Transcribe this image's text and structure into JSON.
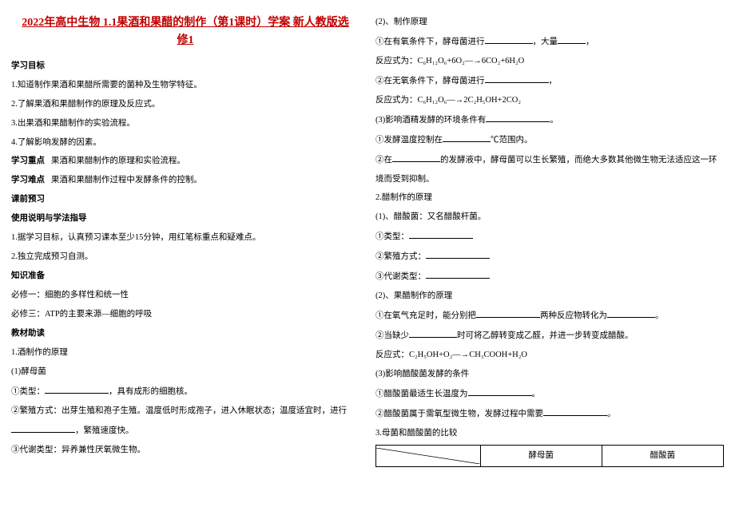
{
  "title_line1": "2022年高中生物 1.1果酒和果醋的制作（第1课时）学案 新人教版选",
  "title_line2": "修1",
  "s_goals_h": "学习目标",
  "goals": [
    "1.知道制作果酒和果醋所需要的菌种及生物学特征。",
    "2.了解果酒和果醋制作的原理及反应式。",
    "3.出果酒和果醋制作的实验流程。",
    "4.了解影响发酵的因素。"
  ],
  "s_focus_h": "学习重点",
  "s_focus_c": "果酒和果醋制作的原理和实验流程。",
  "s_diff_h": "学习难点",
  "s_diff_c": "果酒和果醋制作过程中发酵条件的控制。",
  "s_pre_h": "课前预习",
  "s_guide_h": "使用说明与学法指导",
  "guide1": "1.据学习目标，认真预习课本至少15分钟，用红笔标重点和疑难点。",
  "guide2": "2.独立完成预习自测。",
  "s_prep_h": "知识准备",
  "prep1": "必修一：细胞的多样性和统一性",
  "prep2": "必修三：ATP的主要来源—细胞的呼吸",
  "s_text_h": "教材助读",
  "w1": "1.酒制作的原理",
  "w1_1": "(1)酵母菌",
  "w1_1a_pre": "①类型：",
  "w1_1a_post": "，具有成形的细胞核。",
  "w1_1b": "②繁殖方式：出芽生殖和孢子生殖。温度低时形成孢子，进入休眠状态；温度适宜时，进行",
  "w1_1b_post": "，繁殖速度快。",
  "w1_1c": "③代谢类型：异养兼性厌氧微生物。",
  "w1_2": "(2)、制作原理",
  "w1_2a_pre": "①在有氧条件下，酵母菌进行",
  "w1_2a_mid": "，大量",
  "w1_2a_post": "，",
  "w1_2a_eq": "反应式为：C₆H₁₂O₆+6O₂—→6CO₂+6H₂O",
  "w1_2b_pre": "②在无氧条件下，酵母菌进行",
  "w1_2b_post": "，",
  "w1_2b_eq": "反应式为：C₆H₁₂O₆—→2C₂H₅OH+2CO₂",
  "w1_3_pre": "(3)影响酒精发酵的环境条件有",
  "w1_3_post": "。",
  "w1_3a_pre": "①发酵温度控制在",
  "w1_3a_post": "℃范围内。",
  "w1_3b_pre": "②在",
  "w1_3b_mid": "的发酵液中，酵母菌可以生长繁殖，而绝大多数其他微生物无法适应这一环",
  "w1_3b_post": "境而受到抑制。",
  "w2": "2.醋制作的原理",
  "w2_1": "(1)、醋酸菌：又名醋酸杆菌。",
  "w2_1a": "①类型：",
  "w2_1b": "②繁殖方式：",
  "w2_1c": "③代谢类型：",
  "w2_2": "(2)、果醋制作的原理",
  "w2_2a_pre": "①在氧气充足时，能分别把",
  "w2_2a_mid": "两种反应物转化为",
  "w2_2a_post": "。",
  "w2_2b_pre": "②当缺少",
  "w2_2b_post": "时可将乙醇转变成乙醛，并进一步转变成醋酸。",
  "w2_2b_eq": "反应式：C₂H₅OH+O₂—→CH₃COOH+H₂O",
  "w2_3": "(3)影响醋酸菌发酵的条件",
  "w2_3a_pre": "①醋酸菌最适生长温度为",
  "w2_3a_post": "。",
  "w2_3b_pre": "②醋酸菌属于需氧型微生物，发酵过程中需要",
  "w2_3b_post": "。",
  "w3": "3.母菌和醋酸菌的比较",
  "tbl": {
    "c1": "酵母菌",
    "c2": "醋酸菌"
  }
}
